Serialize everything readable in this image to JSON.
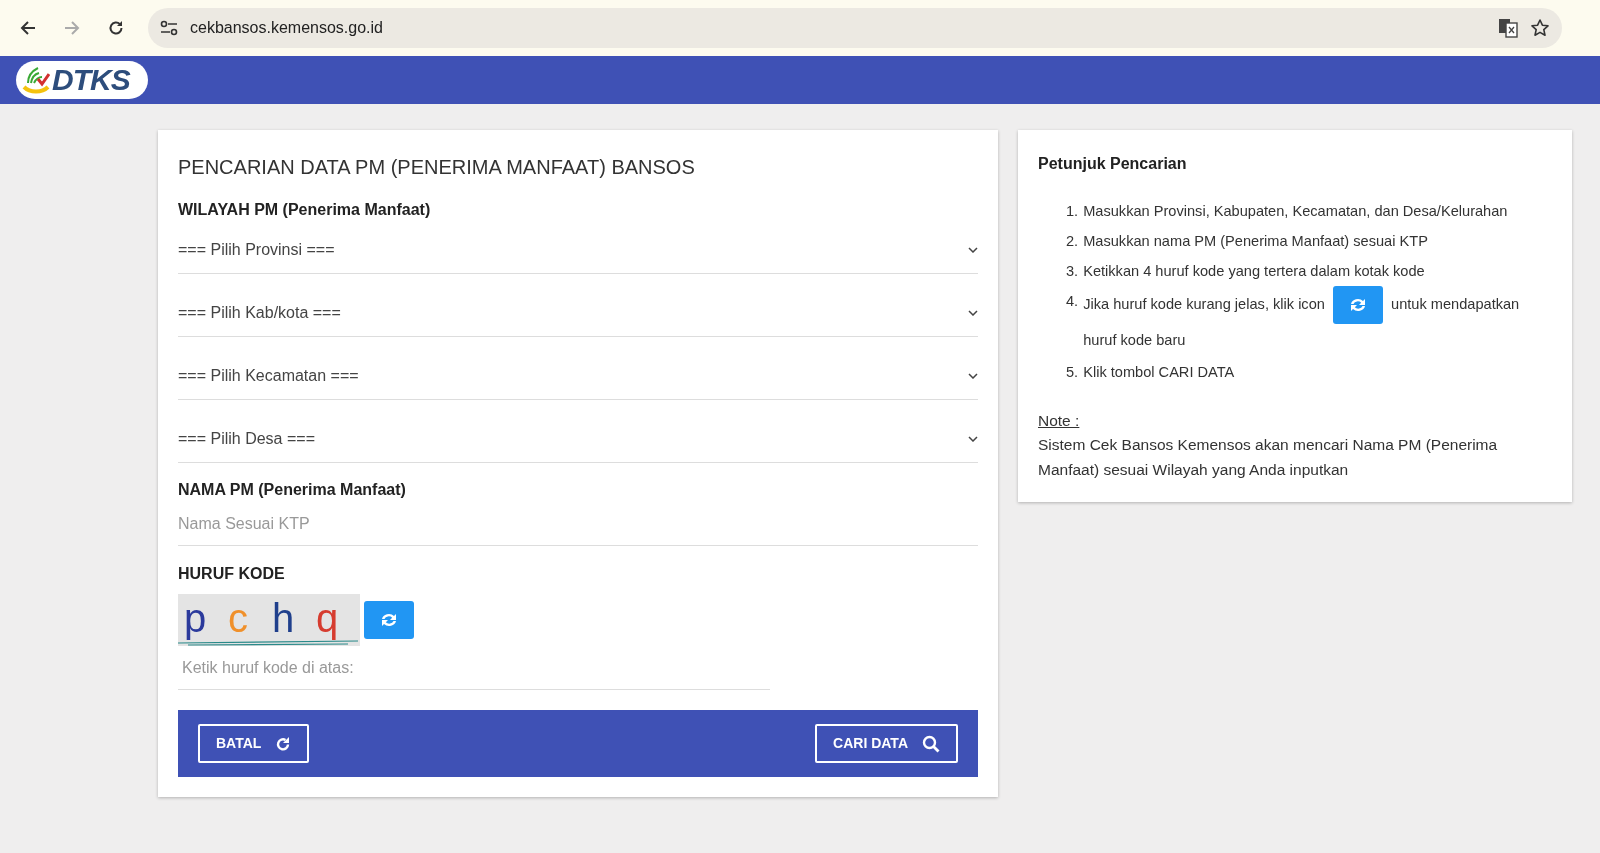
{
  "browser": {
    "url": "cekbansos.kemensos.go.id",
    "forward_disabled": true
  },
  "header": {
    "logo_text": "DTKS"
  },
  "form": {
    "title": "PENCARIAN DATA PM (PENERIMA MANFAAT) BANSOS",
    "region_label": "WILAYAH PM (Penerima Manfaat)",
    "selects": [
      {
        "value": "=== Pilih Provinsi ==="
      },
      {
        "value": "=== Pilih Kab/kota ==="
      },
      {
        "value": "=== Pilih Kecamatan ==="
      },
      {
        "value": "=== Pilih Desa ==="
      }
    ],
    "name_label": "NAMA PM (Penerima Manfaat)",
    "name_placeholder": "Nama Sesuai KTP",
    "code_label": "HURUF KODE",
    "captcha": {
      "letters": [
        "p",
        "c",
        "h",
        "q"
      ]
    },
    "code_placeholder": "Ketik huruf kode di atas:",
    "buttons": [
      {
        "label": "BATAL",
        "kind": "reset"
      },
      {
        "label": "CARI DATA",
        "kind": "search"
      }
    ]
  },
  "help": {
    "title": "Petunjuk Pencarian",
    "steps": [
      {
        "number": "1.",
        "text": "Masukkan Provinsi, Kabupaten, Kecamatan, dan Desa/Kelurahan"
      },
      {
        "number": "2.",
        "text": "Masukkan nama PM (Penerima Manfaat) sesuai KTP"
      },
      {
        "number": "3.",
        "text": "Ketikkan 4 huruf kode yang tertera dalam kotak kode"
      },
      {
        "number": "4.",
        "text": "Jika huruf kode kurang jelas, klik icon",
        "kind": "refresh",
        "text_after": "untuk mendapatkan huruf kode baru"
      },
      {
        "number": "5.",
        "text": "Klik tombol CARI DATA"
      }
    ],
    "note_label": "Note :",
    "note": "Sistem Cek Bansos Kemensos akan mencari Nama PM (Penerima Manfaat) sesuai Wilayah yang Anda inputkan"
  }
}
